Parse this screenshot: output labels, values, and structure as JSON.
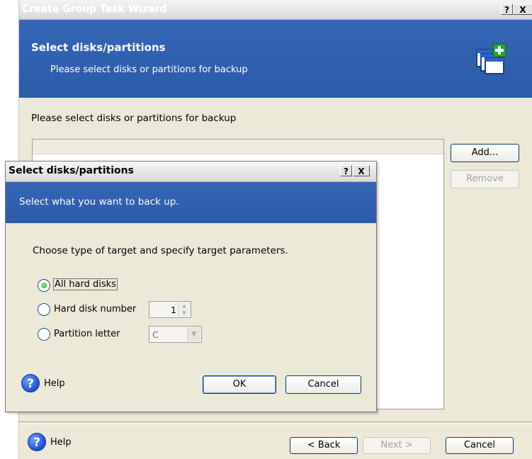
{
  "wizard": {
    "title": "Create Group Task Wizard",
    "help_btn": "?",
    "close_btn": "X",
    "header_title": "Select disks/partitions",
    "header_subtitle": "Please select disks or partitions for backup",
    "instruction": "Please select disks or partitions for backup",
    "add_label": "Add...",
    "remove_label": "Remove",
    "help_label": "Help",
    "back_label": "< Back",
    "next_label": "Next >",
    "cancel_label": "Cancel"
  },
  "dialog": {
    "title": "Select disks/partitions",
    "help_btn": "?",
    "close_btn": "X",
    "header_text": "Select what you want to back up.",
    "instruction": "Choose type of target and specify target parameters.",
    "options": [
      {
        "label": "All hard disks",
        "selected": true
      },
      {
        "label": "Hard disk number",
        "selected": false
      },
      {
        "label": "Partition letter",
        "selected": false
      }
    ],
    "disk_number": "1",
    "partition_letter": "C",
    "help_label": "Help",
    "ok_label": "OK",
    "cancel_label": "Cancel"
  },
  "colors": {
    "header_blue": "#2e5ead",
    "window_bg": "#ece9d8",
    "radio_selected": "#21a121"
  },
  "icons": [
    "help-icon",
    "add-window-icon",
    "spin-up-icon",
    "spin-down-icon",
    "dropdown-arrow-icon"
  ]
}
